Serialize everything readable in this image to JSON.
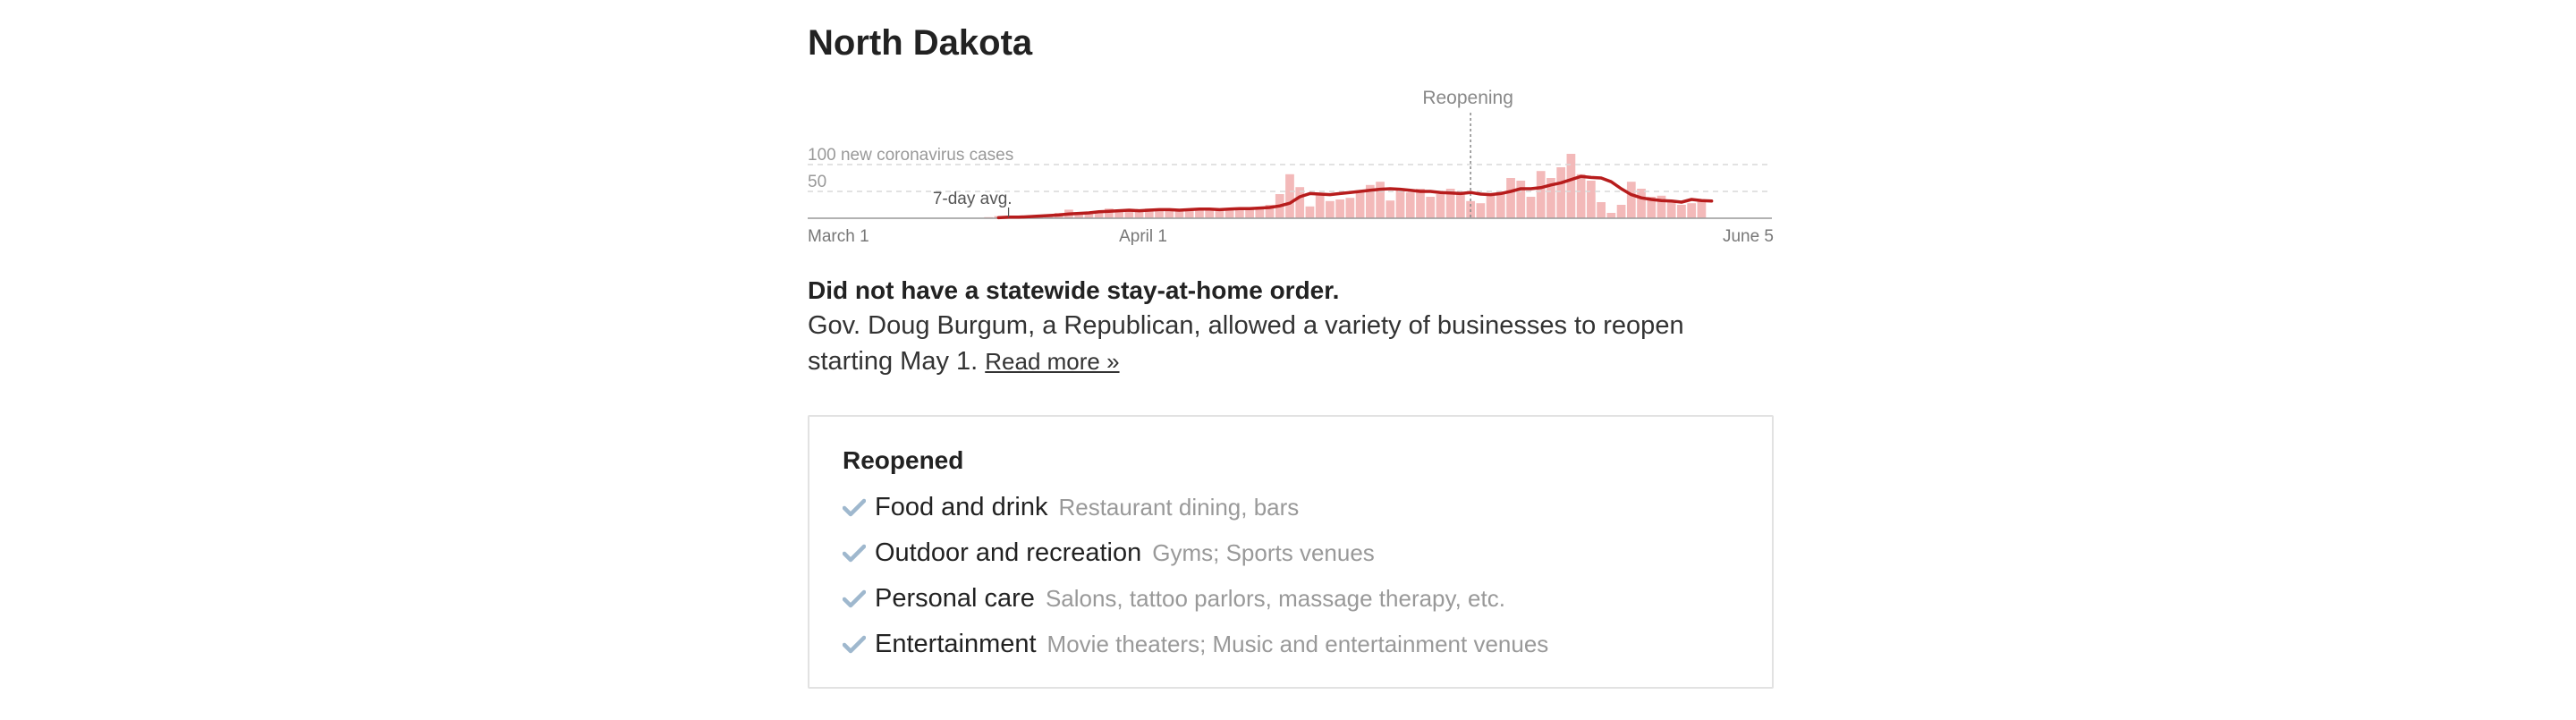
{
  "state": {
    "name": "North Dakota"
  },
  "chart_data": {
    "type": "bar",
    "ylabel": "100 new coronavirus cases",
    "y_ticks": [
      {
        "value": 100,
        "label": "100 new coronavirus cases"
      },
      {
        "value": 50,
        "label": "50"
      }
    ],
    "ylim": [
      0,
      100
    ],
    "x_tick_labels": [
      {
        "day": 0,
        "label": "March 1"
      },
      {
        "day": 31,
        "label": "April 1"
      },
      {
        "day": 96,
        "label": "June 5"
      }
    ],
    "x_range_days": [
      0,
      96
    ],
    "annotation": {
      "label": "Reopening",
      "day": 66
    },
    "avg_label": "7-day avg.",
    "grid": true,
    "colors": {
      "bars": "#f3b9b9",
      "avg_line": "#b71c1c",
      "gridline": "#d9d9d9",
      "axis": "#999999"
    },
    "series": [
      {
        "name": "New cases",
        "start_day": 18,
        "values": [
          2,
          4,
          3,
          2,
          5,
          6,
          4,
          10,
          16,
          8,
          12,
          14,
          18,
          15,
          16,
          14,
          18,
          16,
          14,
          16,
          18,
          15,
          17,
          16,
          19,
          18,
          20,
          17,
          25,
          45,
          82,
          58,
          22,
          45,
          32,
          35,
          38,
          52,
          62,
          68,
          33,
          52,
          48,
          55,
          40,
          45,
          55,
          48,
          32,
          28,
          42,
          50,
          75,
          70,
          40,
          88,
          75,
          95,
          120,
          82,
          70,
          30,
          10,
          25,
          68,
          55,
          40,
          42,
          30,
          25,
          28,
          35
        ]
      },
      {
        "name": "7-day avg.",
        "start_day": 19,
        "values": [
          1,
          2,
          2,
          3,
          4,
          5,
          6,
          8,
          9,
          10,
          12,
          13,
          14,
          15,
          14,
          15,
          16,
          16,
          15,
          16,
          17,
          17,
          16,
          17,
          18,
          18,
          19,
          20,
          23,
          28,
          40,
          46,
          45,
          44,
          46,
          48,
          50,
          52,
          54,
          55,
          54,
          52,
          50,
          50,
          48,
          47,
          46,
          48,
          45,
          44,
          46,
          50,
          55,
          55,
          57,
          62,
          66,
          72,
          78,
          76,
          75,
          68,
          55,
          44,
          38,
          35,
          33,
          32,
          30,
          35,
          33,
          32
        ]
      }
    ]
  },
  "order": {
    "headline": "Did not have a statewide stay-at-home order.",
    "body": "Gov. Doug Burgum, a Republican, allowed a variety of businesses to reopen starting May 1.",
    "read_more": "Read more »"
  },
  "reopened": {
    "title": "Reopened",
    "check_color": "#9fb8ce",
    "items": [
      {
        "name": "Food and drink",
        "detail": "Restaurant dining, bars"
      },
      {
        "name": "Outdoor and recreation",
        "detail": "Gyms; Sports venues"
      },
      {
        "name": "Personal care",
        "detail": "Salons, tattoo parlors, massage therapy, etc."
      },
      {
        "name": "Entertainment",
        "detail": "Movie theaters; Music and entertainment venues"
      }
    ]
  }
}
